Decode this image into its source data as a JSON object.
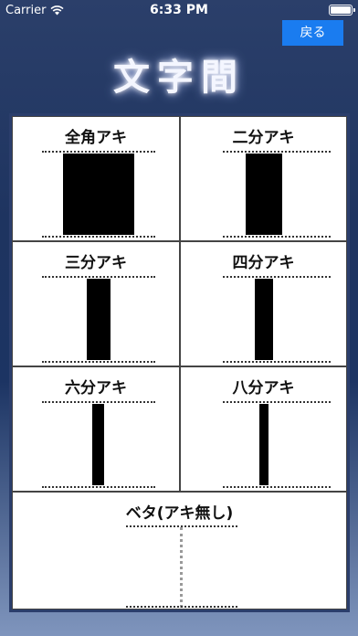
{
  "status": {
    "carrier": "Carrier",
    "time": "6:33 PM"
  },
  "header": {
    "back_label": "戻る",
    "title": "文字間"
  },
  "cells": [
    {
      "label": "全角アキ"
    },
    {
      "label": "二分アキ"
    },
    {
      "label": "三分アキ"
    },
    {
      "label": "四分アキ"
    },
    {
      "label": "六分アキ"
    },
    {
      "label": "八分アキ"
    },
    {
      "label": "ベタ(アキ無し)"
    }
  ]
}
